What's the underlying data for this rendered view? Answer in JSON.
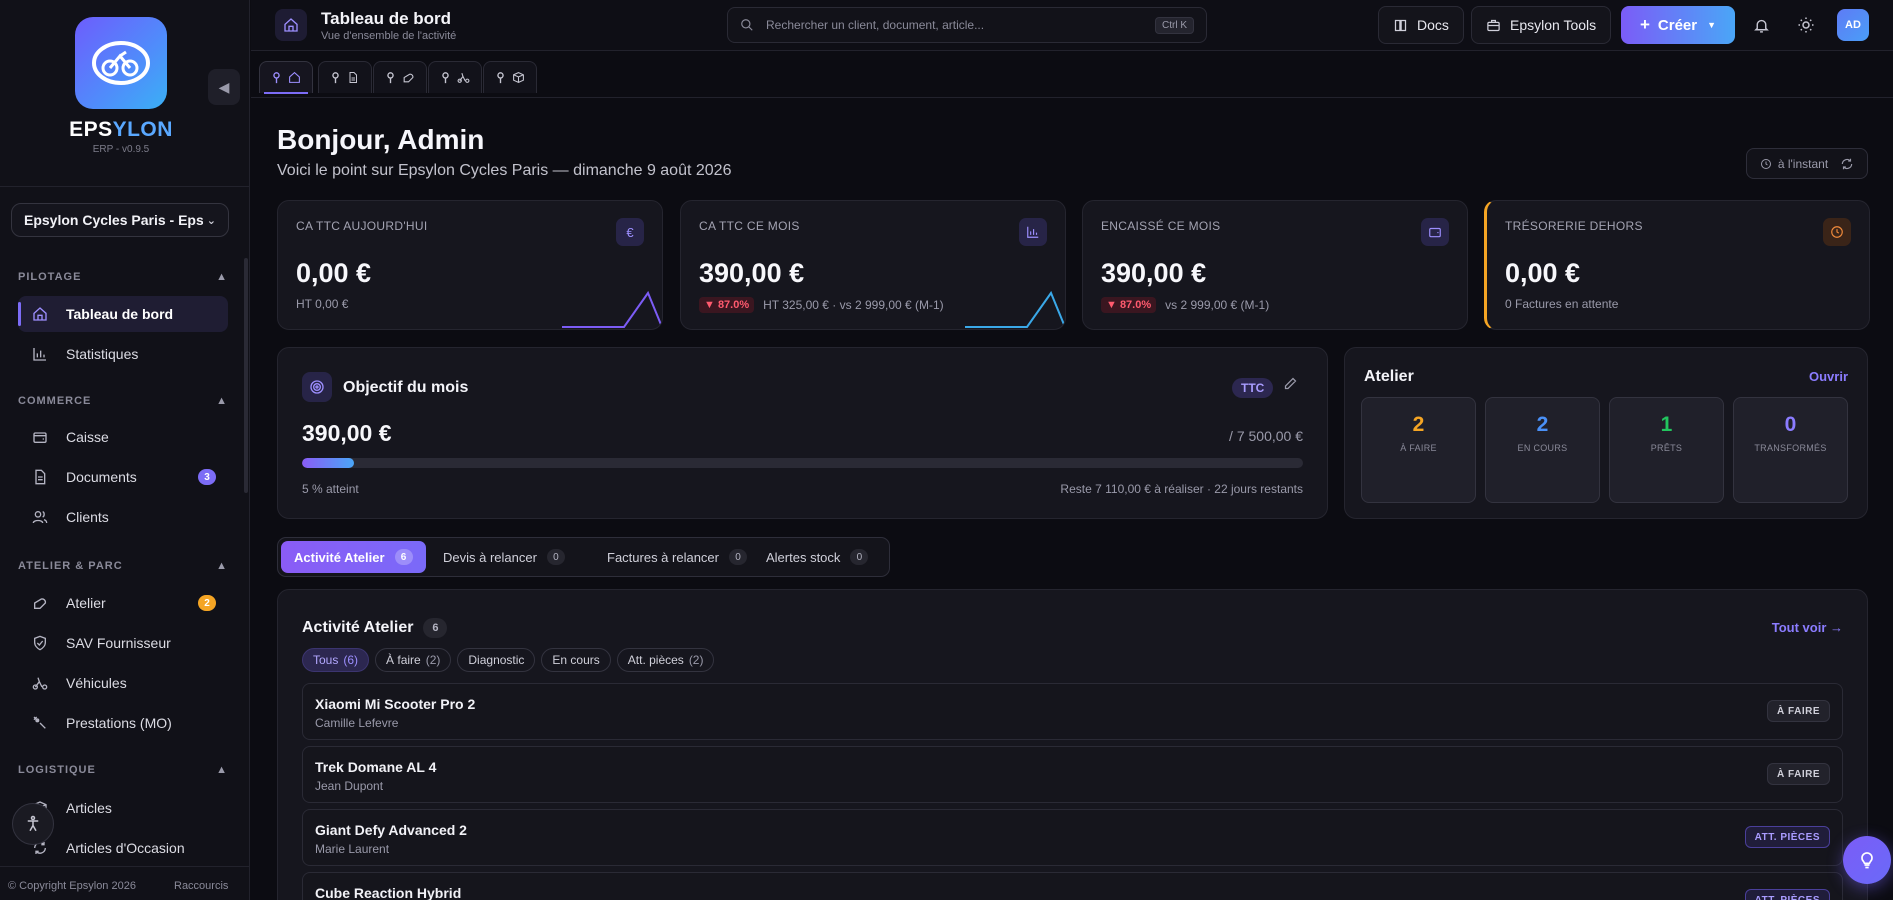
{
  "sidebar": {
    "brand_part1": "EPS",
    "brand_part2": "YLON",
    "version": "ERP - v0.9.5",
    "company": "Epsylon Cycles Paris - Epsylon",
    "sections": [
      {
        "title": "PILOTAGE",
        "items": [
          {
            "label": "Tableau de bord",
            "icon": "home-icon",
            "active": true
          },
          {
            "label": "Statistiques",
            "icon": "chart-icon"
          }
        ]
      },
      {
        "title": "COMMERCE",
        "items": [
          {
            "label": "Caisse",
            "icon": "wallet-icon"
          },
          {
            "label": "Documents",
            "icon": "document-icon",
            "badge": "3",
            "badge_color": "#7c6cf6"
          },
          {
            "label": "Clients",
            "icon": "users-icon"
          }
        ]
      },
      {
        "title": "ATELIER & PARC",
        "items": [
          {
            "label": "Atelier",
            "icon": "wrench-icon",
            "badge": "2",
            "badge_color": "#f5a524"
          },
          {
            "label": "SAV Fournisseur",
            "icon": "shield-icon"
          },
          {
            "label": "Véhicules",
            "icon": "scooter-icon"
          },
          {
            "label": "Prestations (MO)",
            "icon": "tools-icon"
          }
        ]
      },
      {
        "title": "LOGISTIQUE",
        "items": [
          {
            "label": "Articles",
            "icon": "box-icon"
          },
          {
            "label": "Articles d'Occasion",
            "icon": "recycle-icon"
          }
        ]
      }
    ],
    "copyright": "© Copyright Epsylon 2026",
    "shortcuts": "Raccourcis"
  },
  "topbar": {
    "title": "Tableau de bord",
    "subtitle": "Vue d'ensemble de l'activité",
    "search_placeholder": "Rechercher un client, document, article...",
    "search_shortcut": "Ctrl K",
    "docs_label": "Docs",
    "tools_label": "Epsylon Tools",
    "create_label": "Créer",
    "avatar_initials": "AD"
  },
  "pinned_tabs": [
    "home-icon",
    "document-icon",
    "wrench-icon",
    "scooter-icon",
    "box-icon"
  ],
  "greeting": {
    "title": "Bonjour, Admin",
    "subtitle": "Voici le point sur Epsylon Cycles Paris — dimanche 9 août 2026",
    "refresh_label": "à l'instant"
  },
  "kpis": [
    {
      "label": "CA TTC AUJOURD'HUI",
      "value": "0,00 €",
      "foot": "HT 0,00 €",
      "delta": null,
      "icon": "euro-icon",
      "spark": "#7c5cf6"
    },
    {
      "label": "CA TTC CE MOIS",
      "value": "390,00 €",
      "foot": "HT 325,00 € · vs 2 999,00 € (M-1)",
      "delta": "▼ 87.0%",
      "icon": "chart-icon",
      "spark": "#3aa8e8"
    },
    {
      "label": "ENCAISSÉ CE MOIS",
      "value": "390,00 €",
      "foot": "vs 2 999,00 € (M-1)",
      "delta": "▼ 87.0%",
      "icon": "wallet-icon",
      "spark": "#3aa8e8"
    },
    {
      "label": "TRÉSORERIE DEHORS",
      "value": "0,00 €",
      "foot": "0 Factures en attente",
      "delta": null,
      "icon": "clock-icon",
      "spark": null
    }
  ],
  "goal": {
    "title": "Objectif du mois",
    "badge": "TTC",
    "value": "390,00 €",
    "target": "/ 7 500,00 €",
    "progress": 0.052,
    "pct_label": "5 % atteint",
    "rest_label": "Reste 7 110,00 € à réaliser · 22 jours restants"
  },
  "atelier": {
    "title": "Atelier",
    "open_label": "Ouvrir",
    "stats": [
      {
        "num": "2",
        "label": "À FAIRE",
        "color": "#f5a524"
      },
      {
        "num": "2",
        "label": "EN COURS",
        "color": "#4a90f7"
      },
      {
        "num": "1",
        "label": "PRÊTS",
        "color": "#22c55e"
      },
      {
        "num": "0",
        "label": "TRANSFORMÉS",
        "color": "#8b7cff"
      }
    ]
  },
  "segments": [
    {
      "label": "Activité Atelier",
      "count": "6",
      "active": true
    },
    {
      "label": "Devis à relancer",
      "count": "0"
    },
    {
      "label": "Factures à relancer",
      "count": "0"
    },
    {
      "label": "Alertes stock",
      "count": "0"
    }
  ],
  "activity": {
    "title": "Activité Atelier",
    "count": "6",
    "see_all": "Tout voir →",
    "filters": [
      {
        "label": "Tous",
        "n": "(6)",
        "active": true
      },
      {
        "label": "À faire",
        "n": "(2)"
      },
      {
        "label": "Diagnostic",
        "n": ""
      },
      {
        "label": "En cours",
        "n": ""
      },
      {
        "label": "Att. pièces",
        "n": "(2)"
      }
    ],
    "rows": [
      {
        "title": "Xiaomi Mi Scooter Pro 2",
        "client": "Camille Lefevre",
        "status": "À FAIRE",
        "kind": "todo"
      },
      {
        "title": "Trek Domane AL 4",
        "client": "Jean Dupont",
        "status": "À FAIRE",
        "kind": "todo"
      },
      {
        "title": "Giant Defy Advanced 2",
        "client": "Marie Laurent",
        "status": "ATT. PIÈCES",
        "kind": "parts"
      },
      {
        "title": "Cube Reaction Hybrid",
        "client": "",
        "status": "ATT. PIÈCES",
        "kind": "parts"
      }
    ]
  }
}
